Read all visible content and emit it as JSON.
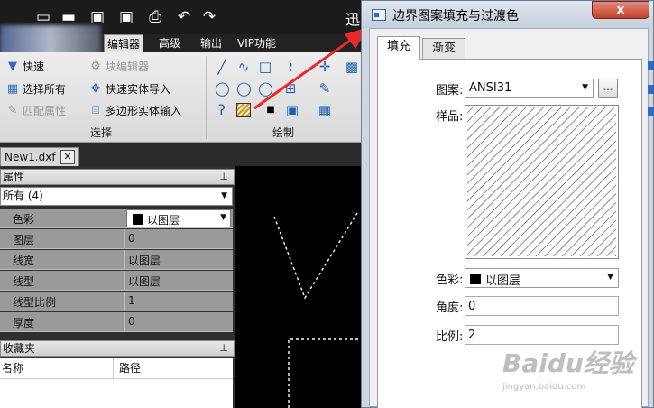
{
  "app": {
    "title_fragment": "迅"
  },
  "ribbon": {
    "tabs": [
      "编辑器",
      "高级",
      "输出",
      "VIP功能"
    ],
    "active_tab": "编辑器",
    "select_group": {
      "label": "选择",
      "items": [
        "快速",
        "选择所有",
        "匹配属性",
        "块编辑器",
        "快速实体导入",
        "多边形实体输入"
      ]
    },
    "draw_group": {
      "label": "绘制"
    }
  },
  "document": {
    "tab": "New1.dxf"
  },
  "properties": {
    "header": "属性",
    "filter": "所有 (4)",
    "rows": [
      {
        "key": "色彩",
        "value": "以图层"
      },
      {
        "key": "图层",
        "value": "0"
      },
      {
        "key": "线宽",
        "value": "以图层"
      },
      {
        "key": "线型",
        "value": "以图层"
      },
      {
        "key": "线型比例",
        "value": "1"
      },
      {
        "key": "厚度",
        "value": "0"
      }
    ]
  },
  "favorites": {
    "header": "收藏夹",
    "columns": [
      "名称",
      "路径"
    ]
  },
  "dialog": {
    "title": "边界图案填充与过渡色",
    "close": "x",
    "tabs": [
      "填充",
      "渐变"
    ],
    "active_tab": "填充",
    "pattern_label": "图案:",
    "pattern_value": "ANSI31",
    "browse": "...",
    "sample_label": "样品:",
    "color_label": "色彩:",
    "color_value": "以图层",
    "angle_label": "角度:",
    "angle_value": "0",
    "scale_label": "比例:",
    "scale_value": "2"
  },
  "watermark": {
    "brand": "Baidu经验",
    "url": "jingyan.baidu.com"
  },
  "colors": {
    "arrow": "#e8282a",
    "dialog_title_bg": "#dfe6ef",
    "close_red": "#c1402c",
    "canvas_bg": "#000000"
  }
}
